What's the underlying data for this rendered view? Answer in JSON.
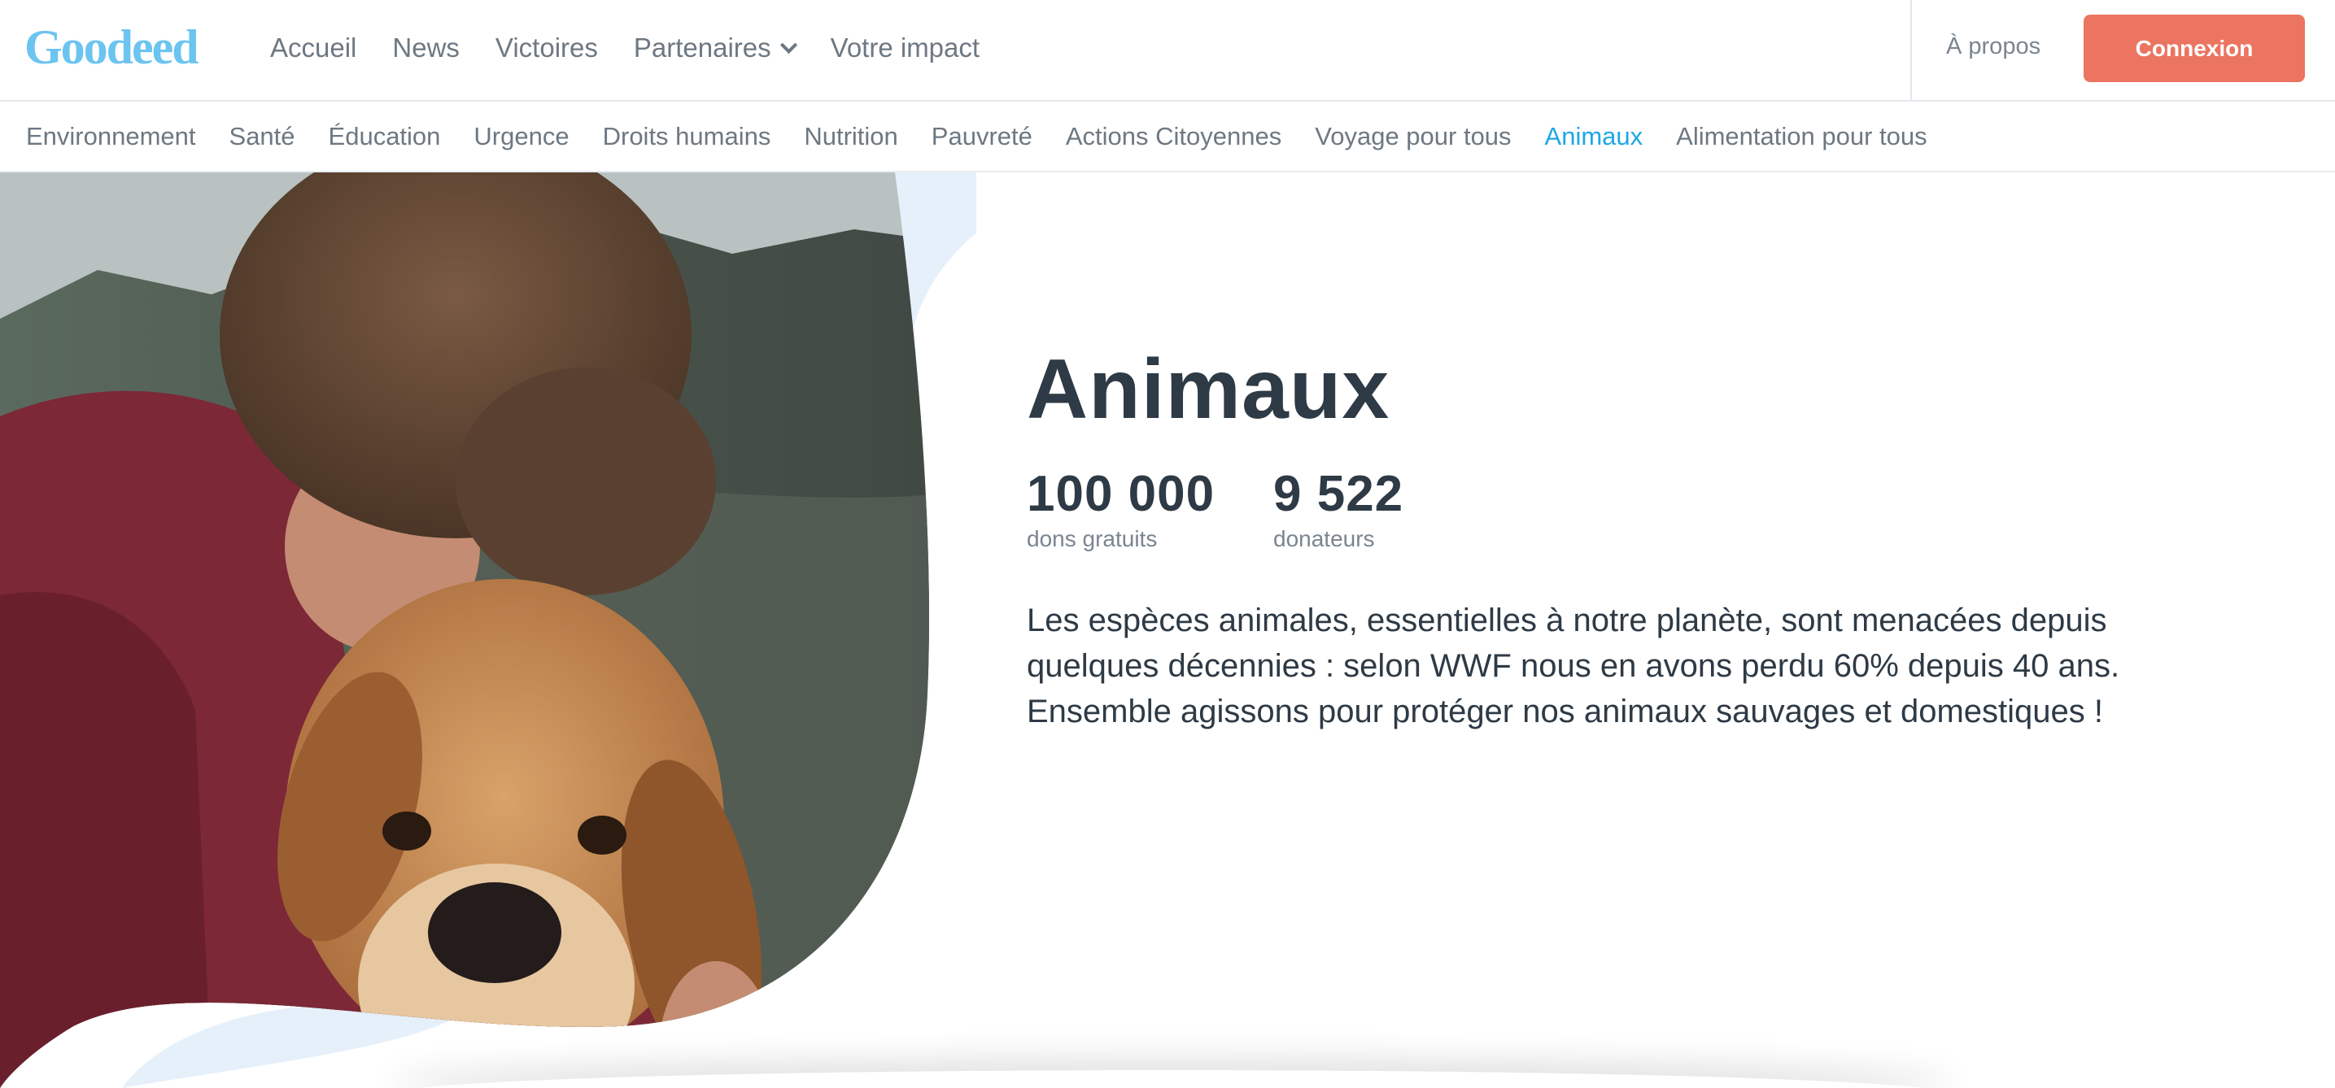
{
  "brand": {
    "logo_text": "Goodeed",
    "logo_color": "#6cc4f0"
  },
  "nav": {
    "items": [
      {
        "label": "Accueil"
      },
      {
        "label": "News"
      },
      {
        "label": "Victoires"
      },
      {
        "label": "Partenaires",
        "has_dropdown": true,
        "icon": "chevron-down-icon"
      },
      {
        "label": "Votre impact"
      }
    ],
    "about_label": "À propos",
    "login_label": "Connexion"
  },
  "categories": {
    "items": [
      {
        "label": "Environnement"
      },
      {
        "label": "Santé"
      },
      {
        "label": "Éducation"
      },
      {
        "label": "Urgence"
      },
      {
        "label": "Droits humains"
      },
      {
        "label": "Nutrition"
      },
      {
        "label": "Pauvreté"
      },
      {
        "label": "Actions Citoyennes"
      },
      {
        "label": "Voyage pour tous"
      },
      {
        "label": "Animaux",
        "active": true
      },
      {
        "label": "Alimentation pour tous"
      }
    ],
    "active_color": "#1ea7e4"
  },
  "hero": {
    "title": "Animaux",
    "stats": [
      {
        "value": "100 000",
        "label": "dons gratuits"
      },
      {
        "value": "9 522",
        "label": "donateurs"
      }
    ],
    "description": "Les espèces animales, essentielles à notre planète, sont menacées depuis quelques décennies : selon WWF nous en avons perdu 60% depuis 40 ans. Ensemble agissons pour protéger nos animaux sauvages et domestiques !",
    "image": "hero-photo-man-hugging-dog"
  },
  "colors": {
    "accent_button": "#eb7560",
    "text_dark": "#2e3a45",
    "text_muted": "#6d7882",
    "blob_light_blue": "#e6f0fa"
  }
}
